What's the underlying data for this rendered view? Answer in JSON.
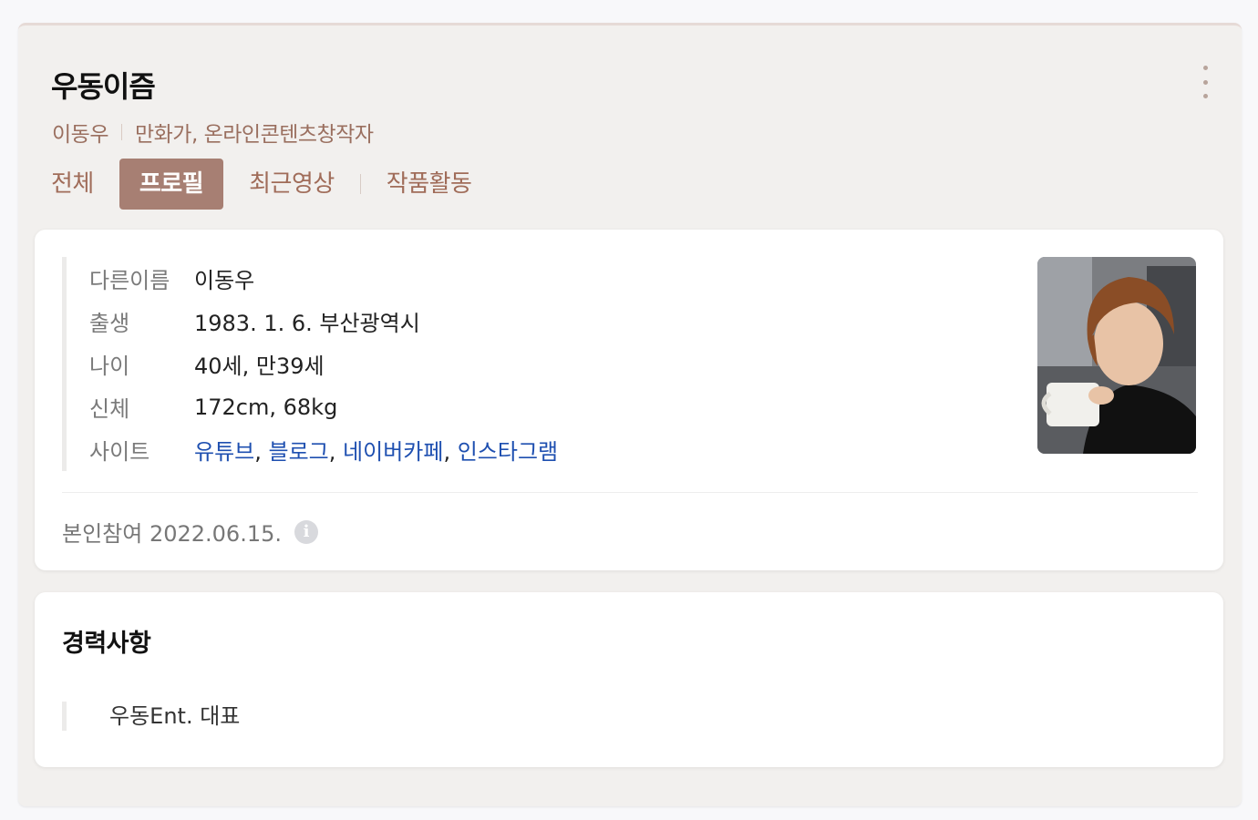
{
  "header": {
    "title": "우동이즘",
    "subtitle_name": "이동우",
    "subtitle_occupation": "만화가, 온라인콘텐츠창작자"
  },
  "tabs": [
    {
      "label": "전체",
      "active": false
    },
    {
      "label": "프로필",
      "active": true
    },
    {
      "label": "최근영상",
      "active": false
    },
    {
      "label": "작품활동",
      "active": false
    }
  ],
  "profile": {
    "rows": [
      {
        "key": "다른이름",
        "value": "이동우"
      },
      {
        "key": "출생",
        "value": "1983. 1. 6. 부산광역시"
      },
      {
        "key": "나이",
        "value": "40세, 만39세"
      },
      {
        "key": "신체",
        "value": "172cm, 68kg"
      }
    ],
    "site_key": "사이트",
    "sites": [
      "유튜브",
      "블로그",
      "네이버카페",
      "인스타그램"
    ],
    "participation": "본인참여 2022.06.15.",
    "photo_icon": "person-photo"
  },
  "career": {
    "title": "경력사항",
    "items": [
      "우동Ent. 대표"
    ]
  },
  "colors": {
    "accent": "#a77f73",
    "tab_text": "#a06c59",
    "link": "#1e4fb0",
    "panel_bg": "#f2f0ee"
  }
}
